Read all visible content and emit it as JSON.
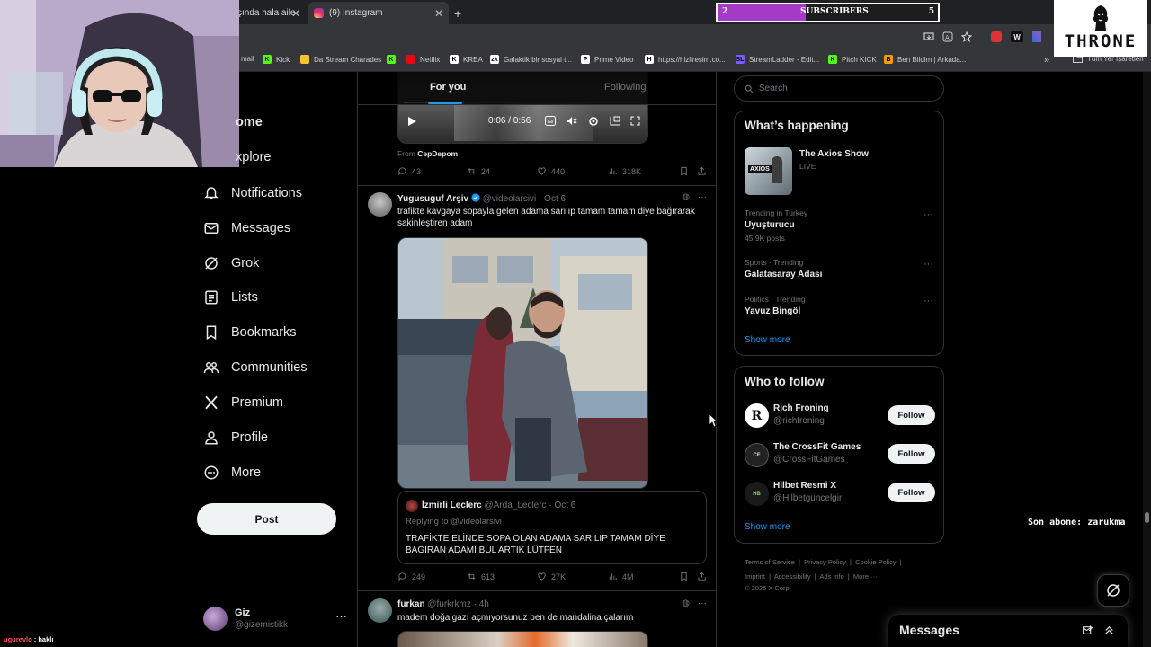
{
  "browser": {
    "tabs": [
      {
        "title": "şında hala aile"
      },
      {
        "title": "(9) Instagram"
      }
    ],
    "address_left_text": "mail",
    "bookmarks": [
      {
        "label": "Kick",
        "color": "#53fc18",
        "letter": "K"
      },
      {
        "label": "Da Stream Charades",
        "color": "#f4c430",
        "letter": ""
      },
      {
        "label": "",
        "color": "#53fc18",
        "letter": "K"
      },
      {
        "label": "Netflix",
        "color": "#e50914",
        "letter": ""
      },
      {
        "label": "KREA",
        "color": "#ffffff",
        "letter": "K"
      },
      {
        "label": "Galaktik bir sosyal t...",
        "color": "#ffffff",
        "letter": "zk"
      },
      {
        "label": "Prime Video",
        "color": "#ffffff",
        "letter": "P"
      },
      {
        "label": "https://hizliresim.co...",
        "color": "#ffffff",
        "letter": "H"
      },
      {
        "label": "StreamLadder - Edit...",
        "color": "#7b5cff",
        "letter": "SL"
      },
      {
        "label": "Pitch KICK",
        "color": "#53fc18",
        "letter": "K"
      },
      {
        "label": "Ben Bildim | Arkada...",
        "color": "#f39c12",
        "letter": "B"
      }
    ],
    "all_bookmarks": "Tüm Yer İşaretleri"
  },
  "overlay": {
    "subs_current": "2",
    "subs_label": "SUBSCRIBERS",
    "subs_goal": "5",
    "subs_progress": 0.4,
    "last_sub": "Son abone: zarukma",
    "chat_user": "ugurevlo",
    "chat_msg": " : haklı",
    "chat_user_color": "#ff5050",
    "logo_text": "THRONE"
  },
  "nav": {
    "items": [
      {
        "label": "ome",
        "icon": "home-icon"
      },
      {
        "label": "xplore",
        "icon": "explore-icon"
      },
      {
        "label": "Notifications",
        "icon": "bell-icon"
      },
      {
        "label": "Messages",
        "icon": "mail-icon"
      },
      {
        "label": "Grok",
        "icon": "grok-icon"
      },
      {
        "label": "Lists",
        "icon": "list-icon"
      },
      {
        "label": "Bookmarks",
        "icon": "bookmark-icon"
      },
      {
        "label": "Communities",
        "icon": "communities-icon"
      },
      {
        "label": "Premium",
        "icon": "x-icon"
      },
      {
        "label": "Profile",
        "icon": "person-icon"
      },
      {
        "label": "More",
        "icon": "more-circle-icon"
      }
    ],
    "post_button": "Post",
    "account": {
      "name": "Giz",
      "handle": "@gizemistikk"
    }
  },
  "timeline": {
    "tabs": {
      "for_you": "For you",
      "following": "Following"
    },
    "post1": {
      "video_time": "0:06 / 0:56",
      "from_label": "From ",
      "from_name": "CepDepom",
      "stats": {
        "replies": "43",
        "reposts": "24",
        "likes": "440",
        "views": "318K"
      }
    },
    "post2": {
      "name": "Yugusuguf Arşiv",
      "handle": "@videolarsivi",
      "date": "· Oct 6",
      "text": "trafikte kavgaya sopayla gelen adama sarılıp tamam tamam diye bağırarak sakinleştiren adam",
      "quote": {
        "name": "İzmirli Leclerc",
        "handle": "@Arda_Leclerc",
        "date": "· Oct 6",
        "replying": "Replying to @videolarsivi",
        "text": "TRAFİKTE ELİNDE SOPA OLAN ADAMA SARILIP TAMAM DİYE BAĞIRAN ADAMI BUL ARTIK LÜTFEN"
      },
      "stats": {
        "replies": "249",
        "reposts": "613",
        "likes": "27K",
        "views": "4M"
      }
    },
    "post3": {
      "name": "furkan",
      "handle": "@furkrkmz",
      "date": "· 4h",
      "text": "madem doğalgazı açmıyorsunuz ben de mandalina çalarım"
    }
  },
  "sidebar": {
    "search_placeholder": "Search",
    "happening": {
      "title": "What’s happening",
      "live": {
        "name": "The Axios Show",
        "status": "LIVE"
      },
      "trends": [
        {
          "context": "Trending in Turkey",
          "name": "Uyuşturucu",
          "posts": "45.9K posts"
        },
        {
          "context": "Sports · Trending",
          "name": "Galatasaray Adası",
          "posts": ""
        },
        {
          "context": "Politics · Trending",
          "name": "Yavuz Bingöl",
          "posts": ""
        }
      ],
      "show_more": "Show more"
    },
    "who_to_follow": {
      "title": "Who to follow",
      "accounts": [
        {
          "name": "Rich Froning",
          "handle": "@richfroning",
          "button": "Follow"
        },
        {
          "name": "The CrossFit Games",
          "handle": "@CrossFitGames",
          "button": "Follow"
        },
        {
          "name": "Hilbet Resmi X",
          "handle": "@Hilbetguncelgir",
          "button": "Follow"
        }
      ],
      "show_more": "Show more"
    },
    "footer": {
      "links": [
        "Terms of Service",
        "Privacy Policy",
        "Cookie Policy",
        "Imprint",
        "Accessibility",
        "Ads info",
        "More ···"
      ],
      "copyright": "© 2025 X Corp."
    }
  },
  "messages_drawer": {
    "title": "Messages"
  },
  "colors": {
    "accent": "#1d9bf0",
    "verified": "#1d9bf0",
    "overlay_purple": "#a33bc7"
  }
}
